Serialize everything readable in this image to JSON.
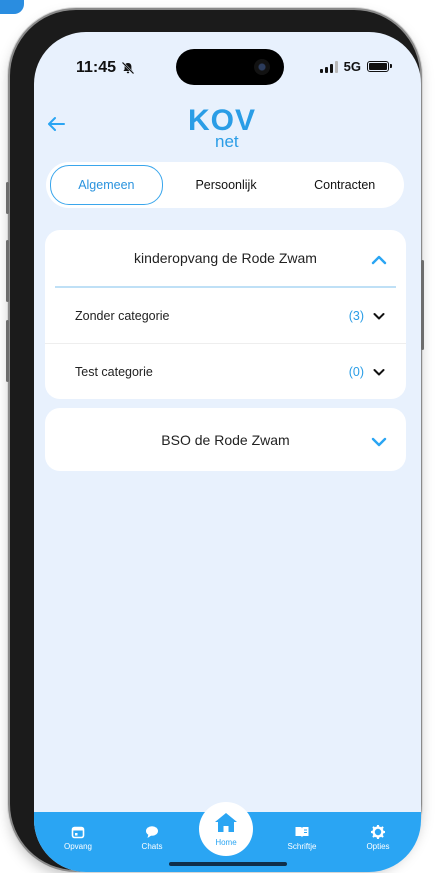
{
  "status_bar": {
    "time": "11:45",
    "network": "5G"
  },
  "logo": {
    "main": "KOV",
    "sub": "net"
  },
  "tabs": [
    {
      "label": "Algemeen",
      "active": true
    },
    {
      "label": "Persoonlijk",
      "active": false
    },
    {
      "label": "Contracten",
      "active": false
    }
  ],
  "locations": [
    {
      "name": "kinderopvang de Rode Zwam",
      "expanded": true,
      "categories": [
        {
          "label": "Zonder categorie",
          "count": "(3)"
        },
        {
          "label": "Test categorie",
          "count": "(0)"
        }
      ]
    },
    {
      "name": "BSO de Rode Zwam",
      "expanded": false
    }
  ],
  "bottom_nav": {
    "opvang": "Opvang",
    "chats": "Chats",
    "home": "Home",
    "schriftje": "Schriftje",
    "opties": "Opties"
  },
  "colors": {
    "accent": "#2aa5f3",
    "screen_bg": "#e8f1fd",
    "count_text": "#2a9de6"
  }
}
